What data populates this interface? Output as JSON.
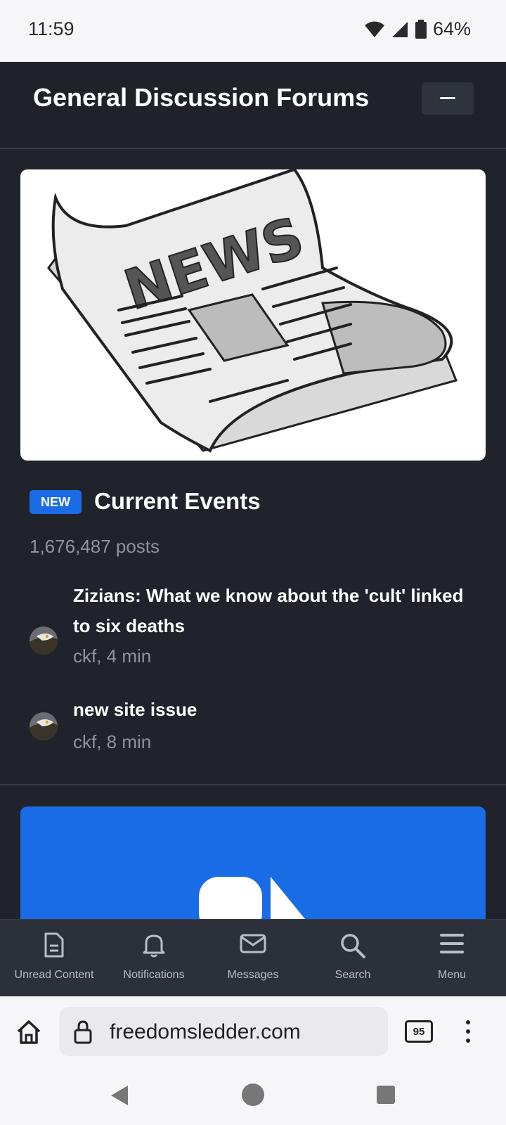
{
  "status_bar": {
    "time": "11:59",
    "battery": "64%"
  },
  "forum": {
    "title": "General Discussion Forums",
    "category": {
      "badge": "NEW",
      "title": "Current Events",
      "posts": "1,676,487 posts",
      "topics": [
        {
          "title": "Zizians: What we know about the 'cult' linked to six deaths",
          "meta": "ckf, 4 min"
        },
        {
          "title": "new site issue",
          "meta": "ckf, 8 min"
        }
      ]
    },
    "news_image_text": "NEWS"
  },
  "bottom_nav": [
    {
      "label": "Unread Content",
      "icon": "document-icon"
    },
    {
      "label": "Notifications",
      "icon": "bell-icon"
    },
    {
      "label": "Messages",
      "icon": "envelope-icon"
    },
    {
      "label": "Search",
      "icon": "search-icon"
    },
    {
      "label": "Menu",
      "icon": "hamburger-icon"
    }
  ],
  "browser": {
    "url": "freedomsledder.com",
    "tab_count": "95"
  },
  "colors": {
    "accent": "#1a6ce6",
    "background": "#20232b"
  }
}
